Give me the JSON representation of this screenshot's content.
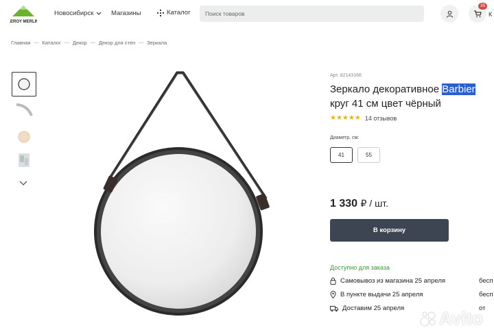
{
  "header": {
    "logo_text": "LEROY MERLIN",
    "city": "Новосибирск",
    "shops": "Магазины",
    "catalog": "Каталог",
    "search_placeholder": "Поиск товаров",
    "cart_count": "35",
    "cart_label": "К"
  },
  "breadcrumb": [
    "Главная",
    "Каталог",
    "Декор",
    "Декор для стен",
    "Зеркала"
  ],
  "product": {
    "article": "Арт. 82143166",
    "title_part1": "Зеркало декоративное ",
    "title_highlight": "Barbier",
    "title_part2": "круг 41 см цвет чёрный",
    "stars": "★★★★★",
    "reviews": "14 отзывов",
    "diameter_label": "Диаметр, см:",
    "sizes": [
      "41",
      "55"
    ],
    "selected_size": "41",
    "price": "1 330",
    "price_unit": "₽ / шт.",
    "buy_label": "В корзину",
    "availability": "Доступно для заказа",
    "delivery": [
      {
        "text": "Самовывоз из магазина 25 апреля",
        "right": "бесп"
      },
      {
        "text": "В пункте выдачи 25 апреля",
        "right": "бесп"
      },
      {
        "text": "Доставим 25 апреля",
        "right": "от"
      }
    ]
  },
  "watermark": "Avito",
  "colors": {
    "accent_green": "#3a9a3a",
    "button_dark": "#3d4452",
    "badge_red": "#d9463b",
    "star_yellow": "#f2b400",
    "highlight_blue": "#2a5fd3"
  }
}
